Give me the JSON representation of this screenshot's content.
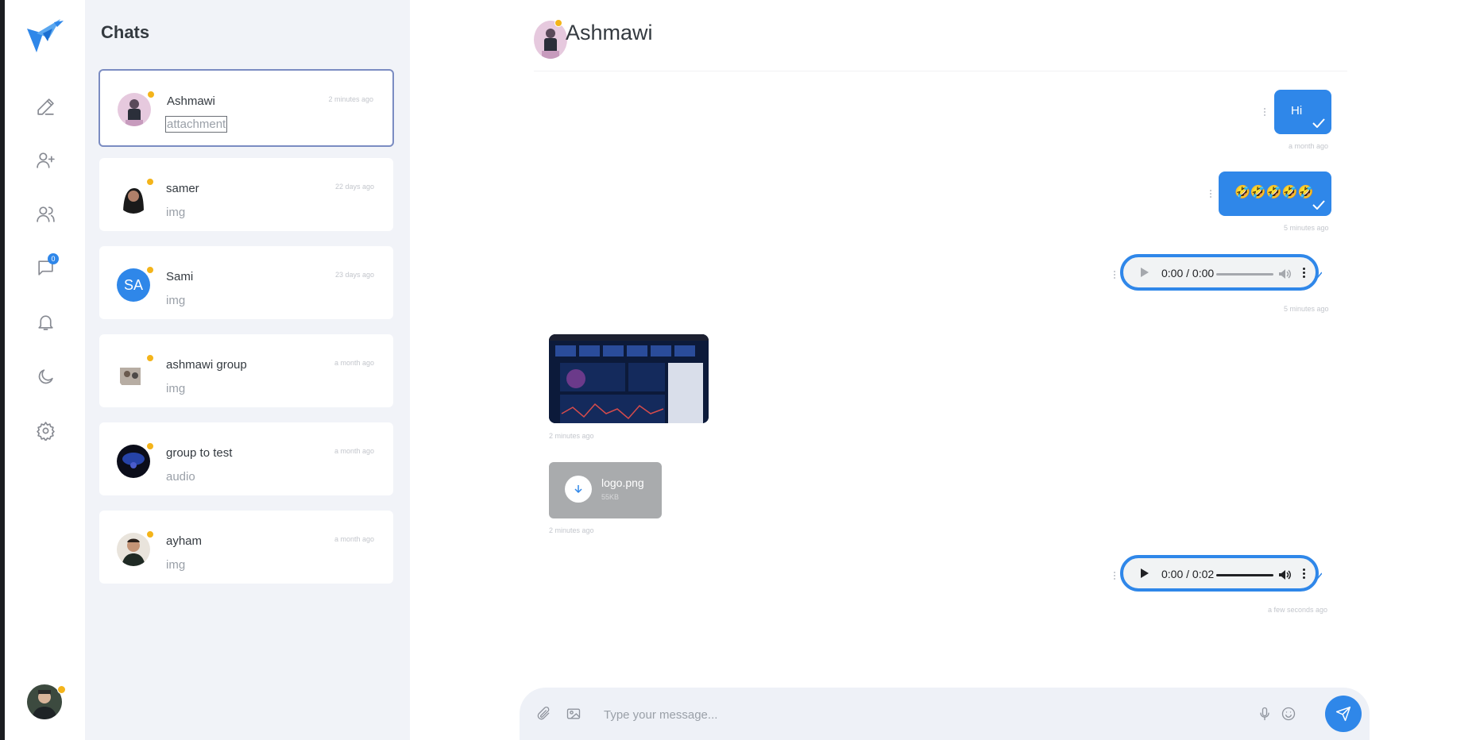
{
  "sidebar": {
    "badge_count": "0",
    "icons": [
      "logo-icon",
      "pencil-icon",
      "add-user-icon",
      "users-icon",
      "chat-icon",
      "bell-icon",
      "moon-icon",
      "gear-icon"
    ]
  },
  "chat_list": {
    "title": "Chats",
    "items": [
      {
        "name": "Ashmawi",
        "time": "2 minutes ago",
        "last": "attachment"
      },
      {
        "name": "samer",
        "time": "22 days ago",
        "last": "img"
      },
      {
        "name": "Sami",
        "initials": "SA",
        "time": "23 days ago",
        "last": "img"
      },
      {
        "name": "ashmawi group",
        "time": "a month ago",
        "last": "img"
      },
      {
        "name": "group to test",
        "time": "a month ago",
        "last": "audio"
      },
      {
        "name": "ayham",
        "time": "a month ago",
        "last": "img"
      }
    ]
  },
  "conversation": {
    "title": "Ashmawi",
    "messages": [
      {
        "type": "text",
        "text": "Hi",
        "time": "a month ago"
      },
      {
        "type": "text",
        "text": "🤣🤣🤣🤣🤣",
        "time": "5 minutes ago"
      },
      {
        "type": "audio",
        "duration": "0:00 / 0:00",
        "time": "5 minutes ago"
      },
      {
        "type": "image",
        "time": "2 minutes ago"
      },
      {
        "type": "file",
        "name": "logo.png",
        "size": "55KB",
        "time": "2 minutes ago"
      },
      {
        "type": "audio",
        "duration": "0:00 / 0:02",
        "time": "a few seconds ago"
      }
    ]
  },
  "composer": {
    "placeholder": "Type your message..."
  },
  "colors": {
    "accent": "#2f87e9",
    "online": "#f4b41a",
    "list_bg": "#f1f3f8"
  }
}
